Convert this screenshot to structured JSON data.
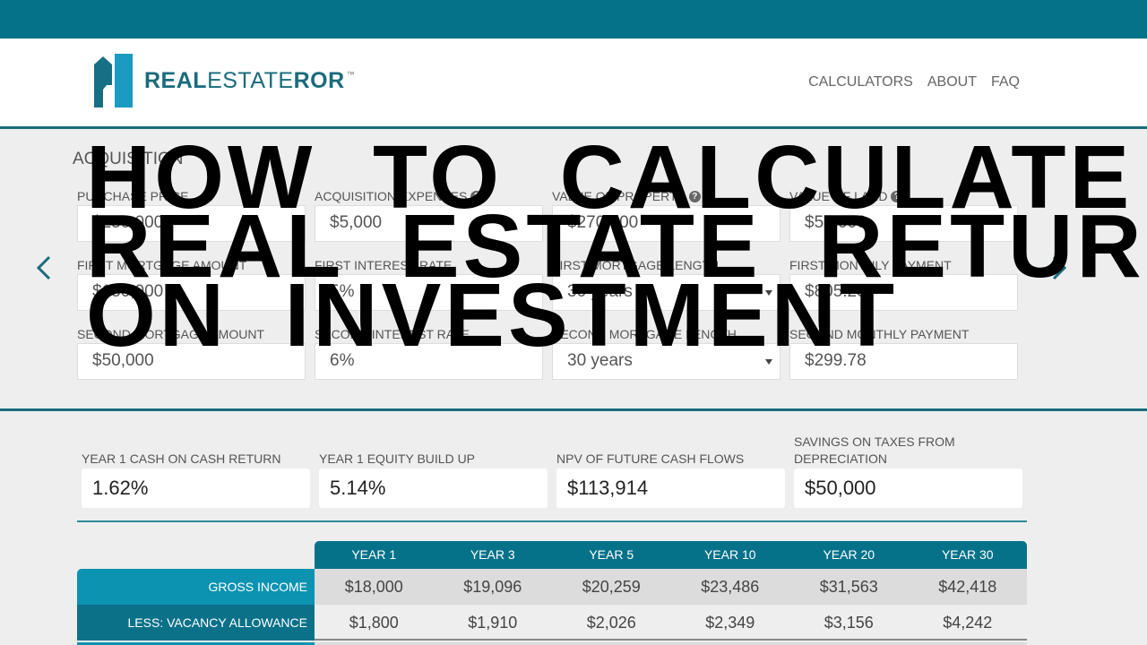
{
  "header": {
    "logo": {
      "bold1": "REAL",
      "light": "ESTATE",
      "bold2": "ROR",
      "tm": "™"
    },
    "nav": [
      "CALCULATORS",
      "ABOUT",
      "FAQ"
    ]
  },
  "acquisition": {
    "title": "ACQUISITION",
    "fields": [
      {
        "label": "PURCHASE PRICE",
        "value": "$250,000",
        "help": false
      },
      {
        "label": "ACQUISITION EXPENSES",
        "value": "$5,000",
        "help": true
      },
      {
        "label": "VALUE OF PROPERTY",
        "value": "$270,000",
        "help": true
      },
      {
        "label": "VALUE OF LAND",
        "value": "$50,000",
        "help": true
      },
      {
        "label": "FIRST MORTGAGE AMOUNT",
        "value": "$150,000",
        "help": false
      },
      {
        "label": "FIRST INTEREST RATE",
        "value": "5%",
        "help": false
      },
      {
        "label": "FIRST MORTGAGE LENGTH",
        "value": "30 years",
        "help": false,
        "select": true
      },
      {
        "label": "FIRST MONTHLY PAYMENT",
        "value": "$805.23",
        "help": false
      },
      {
        "label": "SECOND MORTGAGE AMOUNT",
        "value": "$50,000",
        "help": false
      },
      {
        "label": "SECOND INTEREST RATE",
        "value": "6%",
        "help": false
      },
      {
        "label": "SECOND MORTGAGE LENGTH",
        "value": "30 years",
        "help": false,
        "select": true
      },
      {
        "label": "SECOND MONTHLY PAYMENT",
        "value": "$299.78",
        "help": false
      }
    ],
    "help_glyph": "?"
  },
  "results": [
    {
      "label": "YEAR 1 CASH ON CASH RETURN",
      "value": "1.62%"
    },
    {
      "label": "YEAR 1 EQUITY BUILD UP",
      "value": "5.14%"
    },
    {
      "label": "NPV OF FUTURE CASH FLOWS",
      "value": "$113,914"
    },
    {
      "label": "SAVINGS ON TAXES FROM DEPRECIATION",
      "value": "$50,000"
    }
  ],
  "table": {
    "columns": [
      "YEAR 1",
      "YEAR 3",
      "YEAR 5",
      "YEAR 10",
      "YEAR 20",
      "YEAR 30"
    ],
    "rows": [
      {
        "label": "GROSS INCOME",
        "values": [
          "$18,000",
          "$19,096",
          "$20,259",
          "$23,486",
          "$31,563",
          "$42,418"
        ]
      },
      {
        "label": "LESS: VACANCY ALLOWANCE",
        "values": [
          "$1,800",
          "$1,910",
          "$2,026",
          "$2,349",
          "$3,156",
          "$4,242"
        ]
      }
    ]
  },
  "overlay_title": [
    "HOW  TO  CALCULATE",
    "REAL  ESTATE  RETURN",
    "ON  INVESTMENT"
  ],
  "colors": {
    "brand": "#05728a",
    "brand_dark": "#1a6b7c",
    "row_light": "#0b93b1",
    "row_dark": "#0a7189"
  }
}
